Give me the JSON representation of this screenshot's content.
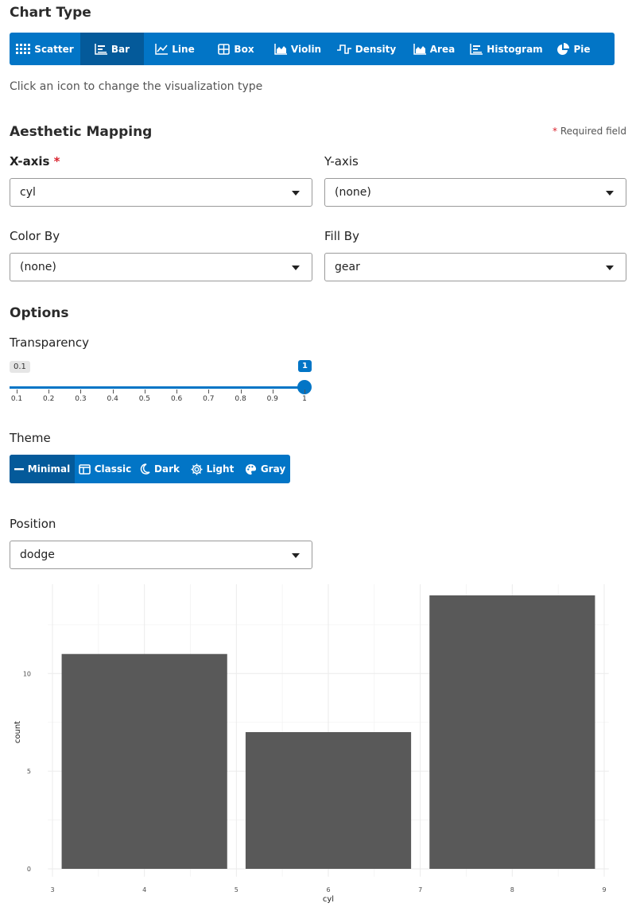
{
  "chart_type": {
    "title": "Chart Type",
    "buttons": [
      {
        "label": "Scatter",
        "icon": "grid-dots-icon",
        "active": false
      },
      {
        "label": "Bar",
        "icon": "bar-chart-icon",
        "active": true
      },
      {
        "label": "Line",
        "icon": "line-chart-icon",
        "active": false
      },
      {
        "label": "Box",
        "icon": "box-plot-icon",
        "active": false
      },
      {
        "label": "Violin",
        "icon": "area-icon",
        "active": false
      },
      {
        "label": "Density",
        "icon": "step-wave-icon",
        "active": false
      },
      {
        "label": "Area",
        "icon": "area-icon",
        "active": false
      },
      {
        "label": "Histogram",
        "icon": "bar-chart-icon",
        "active": false
      },
      {
        "label": "Pie",
        "icon": "pie-icon",
        "active": false
      }
    ],
    "hint": "Click an icon to change the visualization type"
  },
  "aesthetic": {
    "title": "Aesthetic Mapping",
    "required_star": "*",
    "required_note": "Required field",
    "x_label": "X-axis",
    "x_value": "cyl",
    "y_label": "Y-axis",
    "y_value": "(none)",
    "color_label": "Color By",
    "color_value": "(none)",
    "fill_label": "Fill By",
    "fill_value": "gear"
  },
  "options": {
    "title": "Options",
    "transparency_label": "Transparency",
    "slider": {
      "min_badge": "0.1",
      "value_badge": "1",
      "min": 0.1,
      "max": 1,
      "value": 1,
      "ticks": [
        "0.1",
        "0.2",
        "0.3",
        "0.4",
        "0.5",
        "0.6",
        "0.7",
        "0.8",
        "0.9",
        "1"
      ]
    },
    "theme_label": "Theme",
    "themes": [
      {
        "label": "Minimal",
        "icon": "minus-icon",
        "active": true
      },
      {
        "label": "Classic",
        "icon": "window-icon",
        "active": false
      },
      {
        "label": "Dark",
        "icon": "moon-icon",
        "active": false
      },
      {
        "label": "Light",
        "icon": "gear-icon",
        "active": false
      },
      {
        "label": "Gray",
        "icon": "palette-icon",
        "active": false
      }
    ],
    "position_label": "Position",
    "position_value": "dodge"
  },
  "colors": {
    "accent": "#0275c6",
    "accent_dark": "#045a9a",
    "bar": "#595959",
    "required": "#d9232e"
  },
  "chart_data": {
    "type": "bar",
    "title": "",
    "xlabel": "cyl",
    "ylabel": "count",
    "categories": [
      "4",
      "6",
      "8"
    ],
    "x": [
      4,
      6,
      8
    ],
    "values": [
      11,
      7,
      14
    ],
    "bar_width": 1.8,
    "xlim": [
      3,
      9
    ],
    "ylim": [
      0,
      14
    ],
    "x_ticks": [
      "3",
      "4",
      "5",
      "6",
      "7",
      "8",
      "9"
    ],
    "y_ticks": [
      "0",
      "5",
      "10"
    ],
    "grid": true,
    "theme": "minimal"
  }
}
